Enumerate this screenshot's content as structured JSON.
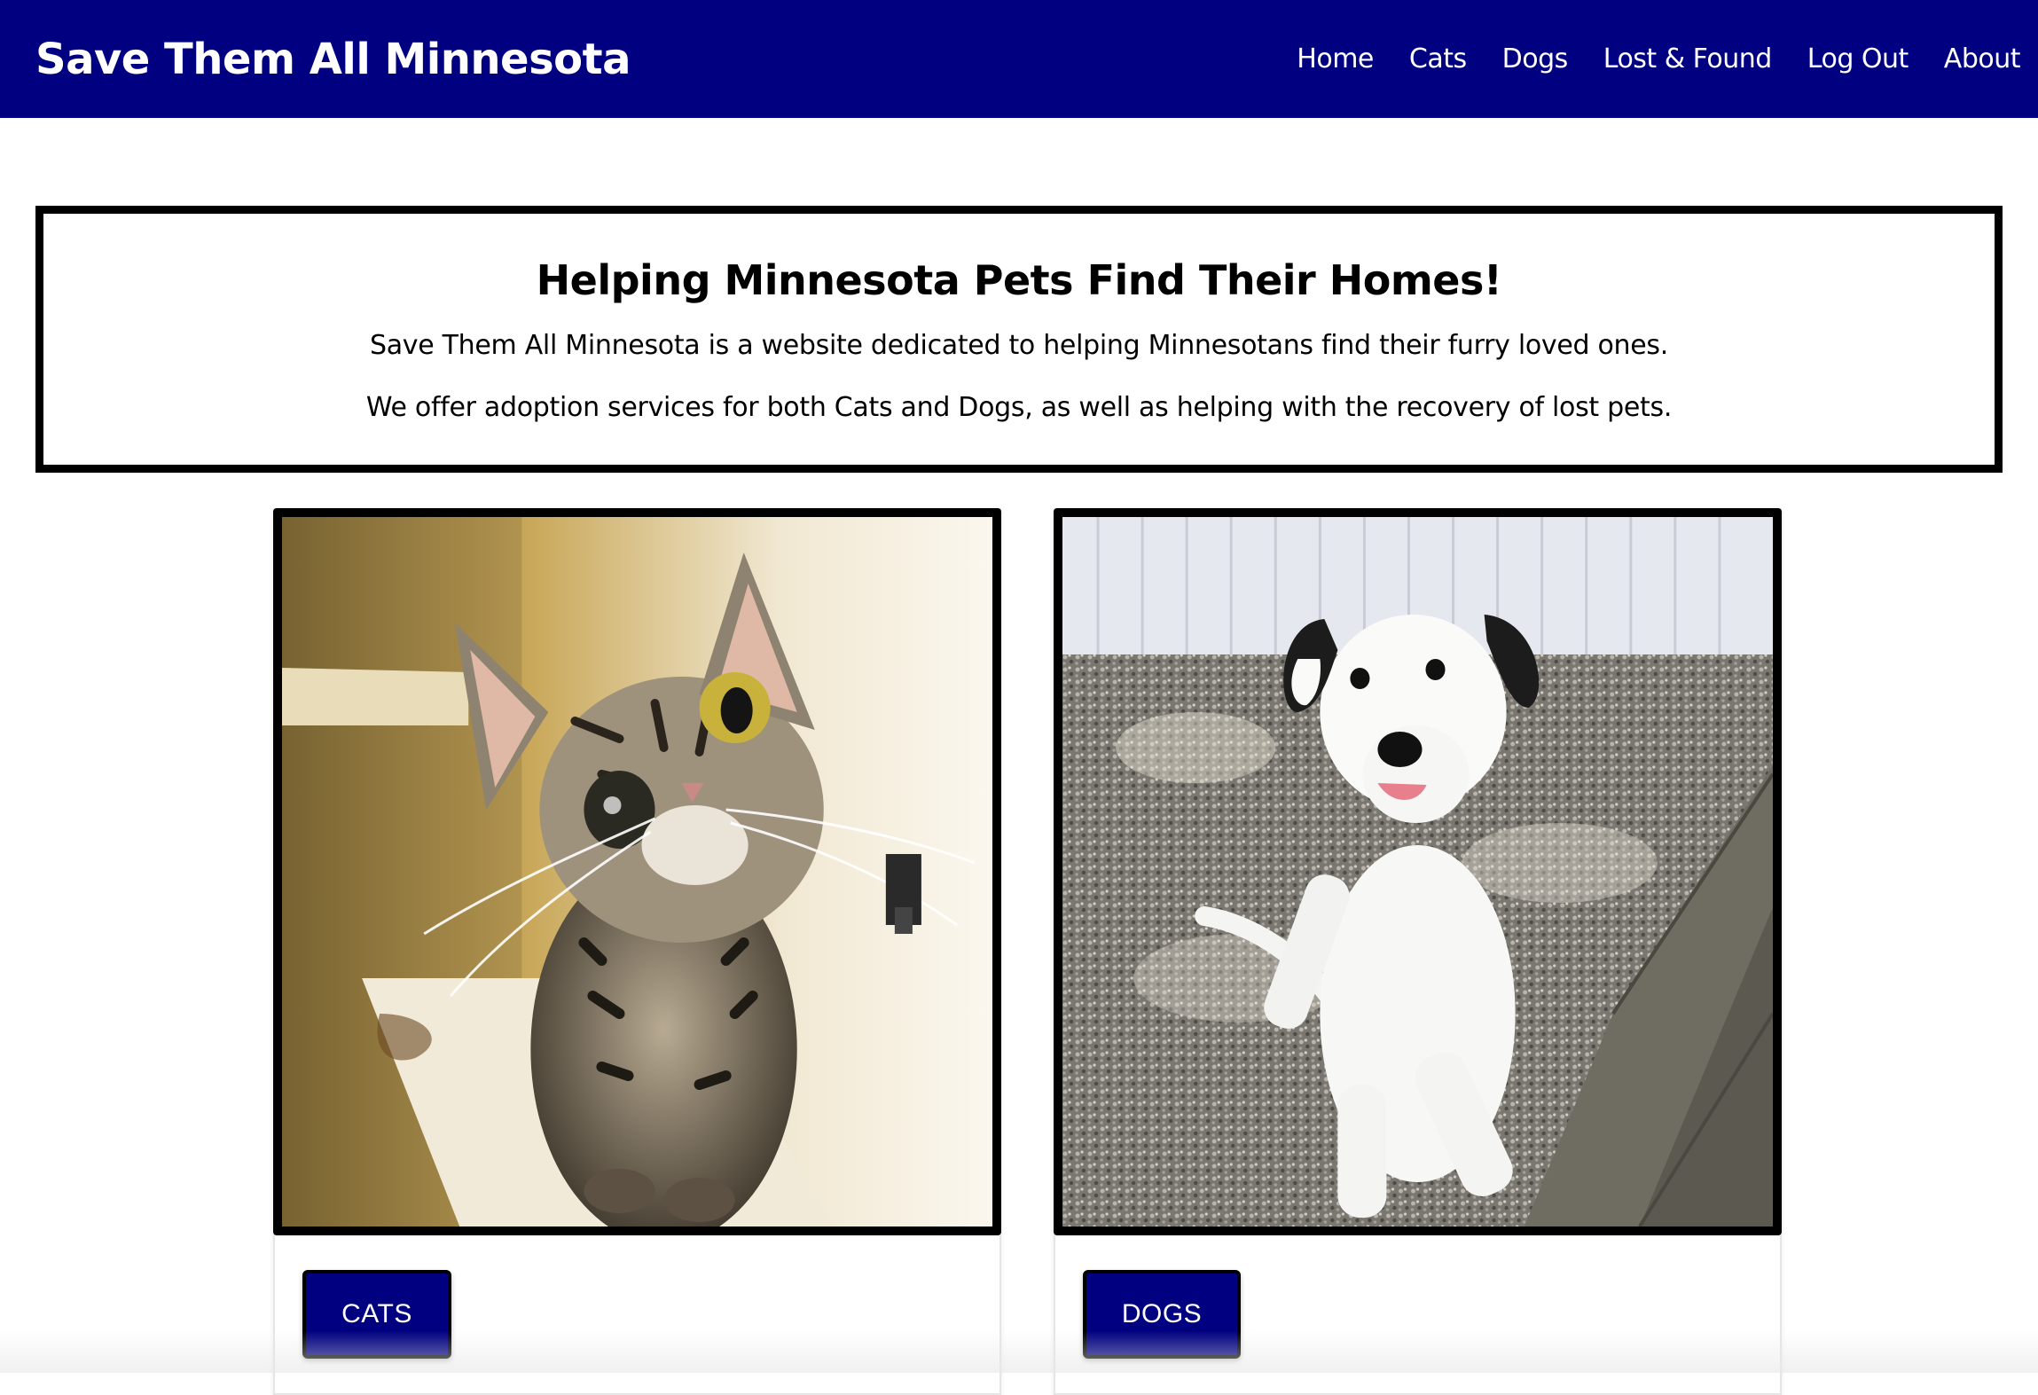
{
  "navbar": {
    "brand": "Save Them All Minnesota",
    "links": [
      {
        "label": "Home"
      },
      {
        "label": "Cats"
      },
      {
        "label": "Dogs"
      },
      {
        "label": "Lost & Found"
      },
      {
        "label": "Log Out"
      },
      {
        "label": "About"
      }
    ]
  },
  "hero": {
    "title": "Helping Minnesota Pets Find Their Homes!",
    "line1": "Save Them All Minnesota is a website dedicated to helping Minnesotans find their furry loved ones.",
    "line2": "We offer adoption services for both Cats and Dogs, as well as helping with the recovery of lost pets."
  },
  "cards": [
    {
      "button_label": "CATS",
      "image": "tabby-kitten-photo"
    },
    {
      "button_label": "DOGS",
      "image": "white-puppy-photo"
    }
  ],
  "colors": {
    "navbar_bg": "#000080",
    "button_bg": "#000080",
    "border": "#000000"
  }
}
